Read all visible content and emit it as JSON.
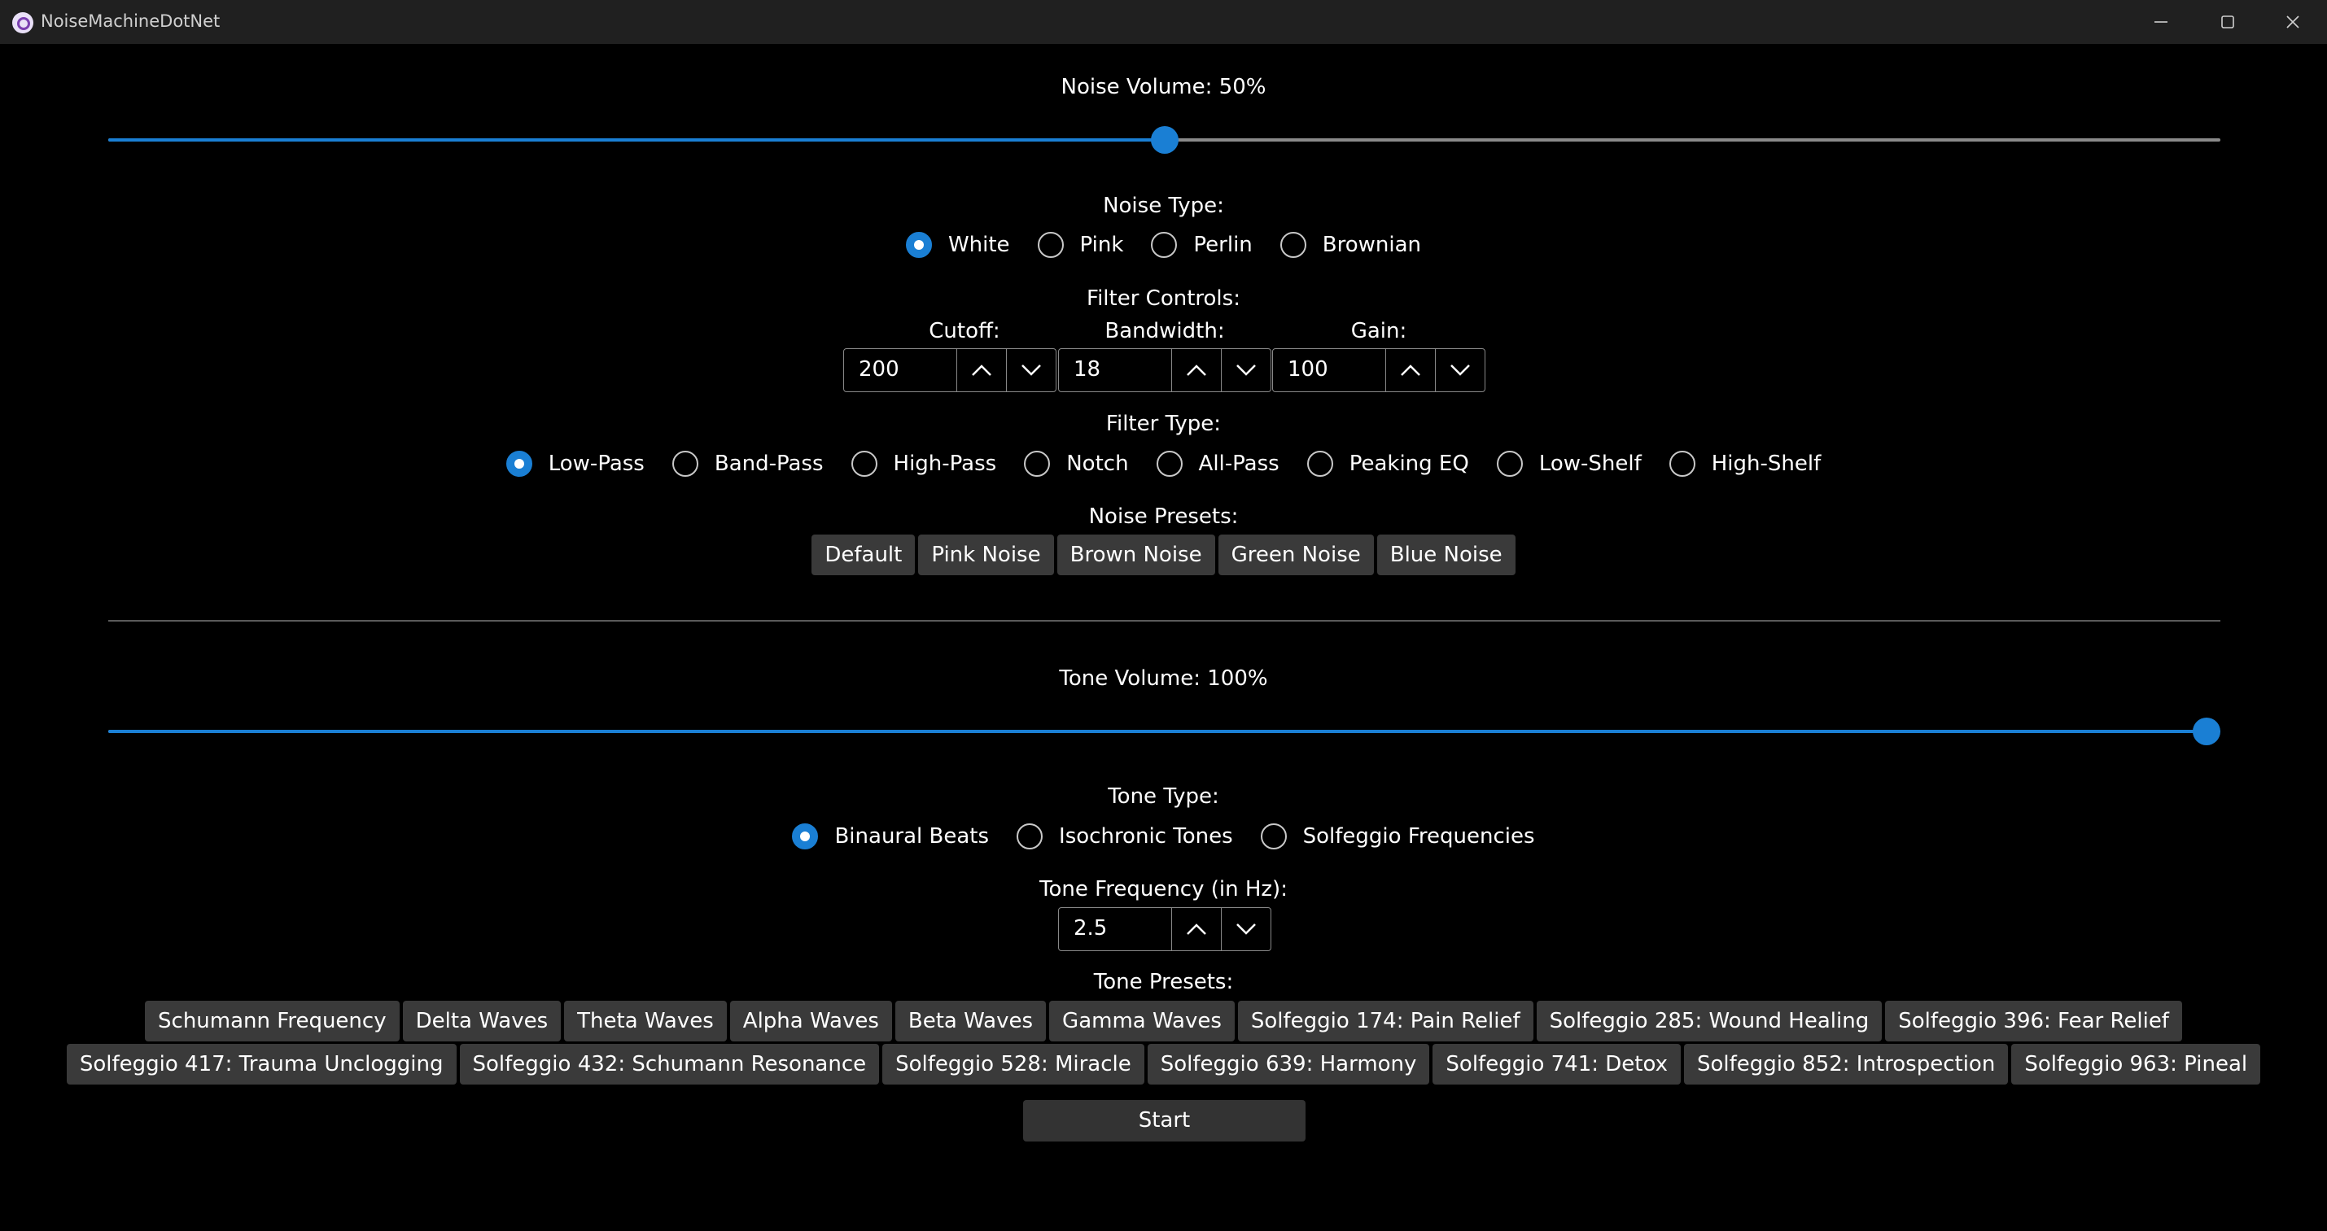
{
  "window": {
    "title": "NoiseMachineDotNet",
    "icons": [
      "app-icon",
      "minimize-icon",
      "maximize-icon",
      "close-icon"
    ]
  },
  "noise": {
    "volume_label": "Noise Volume: 50%",
    "volume_value": 0.5,
    "type_label": "Noise Type:",
    "types": [
      {
        "label": "White",
        "selected": true
      },
      {
        "label": "Pink",
        "selected": false
      },
      {
        "label": "Perlin",
        "selected": false
      },
      {
        "label": "Brownian",
        "selected": false
      }
    ],
    "filter_controls_label": "Filter Controls:",
    "cutoff": {
      "label": "Cutoff:",
      "value": "200"
    },
    "bandwidth": {
      "label": "Bandwidth:",
      "value": "18"
    },
    "gain": {
      "label": "Gain:",
      "value": "100"
    },
    "filter_type_label": "Filter Type:",
    "filter_types": [
      {
        "label": "Low-Pass",
        "selected": true
      },
      {
        "label": "Band-Pass",
        "selected": false
      },
      {
        "label": "High-Pass",
        "selected": false
      },
      {
        "label": "Notch",
        "selected": false
      },
      {
        "label": "All-Pass",
        "selected": false
      },
      {
        "label": "Peaking EQ",
        "selected": false
      },
      {
        "label": "Low-Shelf",
        "selected": false
      },
      {
        "label": "High-Shelf",
        "selected": false
      }
    ],
    "presets_label": "Noise Presets:",
    "presets": [
      "Default",
      "Pink Noise",
      "Brown Noise",
      "Green Noise",
      "Blue Noise"
    ]
  },
  "tone": {
    "volume_label": "Tone Volume: 100%",
    "volume_value": 1.0,
    "type_label": "Tone Type:",
    "types": [
      {
        "label": "Binaural Beats",
        "selected": true
      },
      {
        "label": "Isochronic Tones",
        "selected": false
      },
      {
        "label": "Solfeggio Frequencies",
        "selected": false
      }
    ],
    "frequency_label": "Tone Frequency (in Hz):",
    "frequency_value": "2.5",
    "presets_label": "Tone Presets:",
    "presets_row1": [
      "Schumann Frequency",
      "Delta Waves",
      "Theta Waves",
      "Alpha Waves",
      "Beta Waves",
      "Gamma Waves",
      "Solfeggio 174: Pain Relief",
      "Solfeggio 285: Wound Healing",
      "Solfeggio 396: Fear Relief"
    ],
    "presets_row2": [
      "Solfeggio 417: Trauma Unclogging",
      "Solfeggio 432: Schumann Resonance",
      "Solfeggio 528: Miracle",
      "Solfeggio 639: Harmony",
      "Solfeggio 741: Detox",
      "Solfeggio 852: Introspection",
      "Solfeggio 963: Pineal"
    ]
  },
  "start_label": "Start",
  "colors": {
    "accent": "#1a7fd4",
    "background": "#000000",
    "titlebar": "#202020",
    "button": "#3a3a3a"
  }
}
